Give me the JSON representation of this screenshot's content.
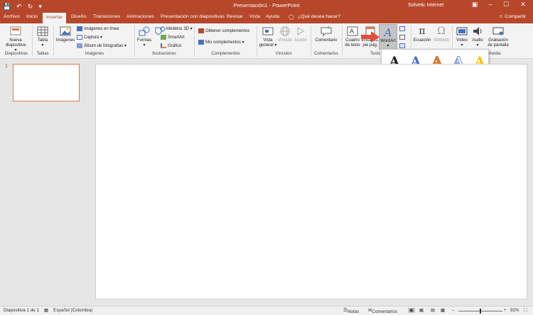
{
  "titlebar": {
    "title": "Presentación1 - PowerPoint",
    "user": "Solvetic Internet",
    "save_icon": "save-icon",
    "undo_icon": "undo-icon",
    "redo_icon": "redo-icon",
    "customize_icon": "customize-qat-icon"
  },
  "tabs": [
    "Archivo",
    "Inicio",
    "Insertar",
    "Diseño",
    "Transiciones",
    "Animaciones",
    "Presentación con diapositivas",
    "Revisar",
    "Vista",
    "Ayuda"
  ],
  "active_tab": "Insertar",
  "tell_me": "¿Qué desea hacer?",
  "share": "Compartir",
  "ribbon": {
    "groups": {
      "diapositivas": "Diapositivas",
      "tablas": "Tablas",
      "imagenes": "Imágenes",
      "ilustraciones": "Ilustraciones",
      "complementos": "Complementos",
      "vinculos": "Vínculos",
      "comentarios": "Comentarios",
      "texto": "Texto",
      "multimedia": "Multimedia"
    },
    "nueva_diapositiva": [
      "Nueva",
      "diapositiva ▾"
    ],
    "tabla": [
      "Tabla",
      "▾"
    ],
    "imagenes": "Imágenes",
    "imagenes_en_linea": "Imágenes en línea",
    "captura": "Captura ▾",
    "album": "Álbum de fotografías ▾",
    "formas": [
      "Formas",
      "▾"
    ],
    "iconos": "Iconos",
    "modelos_3d": "Modelos 3D ▾",
    "smartart": "SmartArt",
    "grafico": "Gráfico",
    "obtener_complementos": "Obtener complementos",
    "mis_complementos": "Mis complementos ▾",
    "vista_general": [
      "Vista",
      "general ▾"
    ],
    "vinculo": "Vínculo",
    "accion": "Acción",
    "comentario": "Comentario",
    "cuadro_de_texto": [
      "Cuadro",
      "de texto"
    ],
    "encabezado": [
      "Encabez.",
      "pie pág."
    ],
    "wordart": "WordArt",
    "ecuacion": "Ecuación",
    "simbolo": "Símbolo",
    "video": "Vídeo",
    "audio": "Audio",
    "grabacion": [
      "Grabación",
      "de pantalla"
    ]
  },
  "gallery": {
    "glyph": "A",
    "colors": {
      "black": "#1a1a1a",
      "blue": "#4472c4",
      "orange": "#ed7d31",
      "light_blue": "#a9c4eb",
      "gold": "#ffc000",
      "gray": "#7f7f7f",
      "yellow": "#ffd966"
    }
  },
  "slides": {
    "thumbnail_number": "1"
  },
  "statusbar": {
    "slide_info": "Diapositiva 1 de 1",
    "language": "Español (Colombia)",
    "notes": "Notas",
    "comments": "Comentarios",
    "zoom": "92%"
  }
}
